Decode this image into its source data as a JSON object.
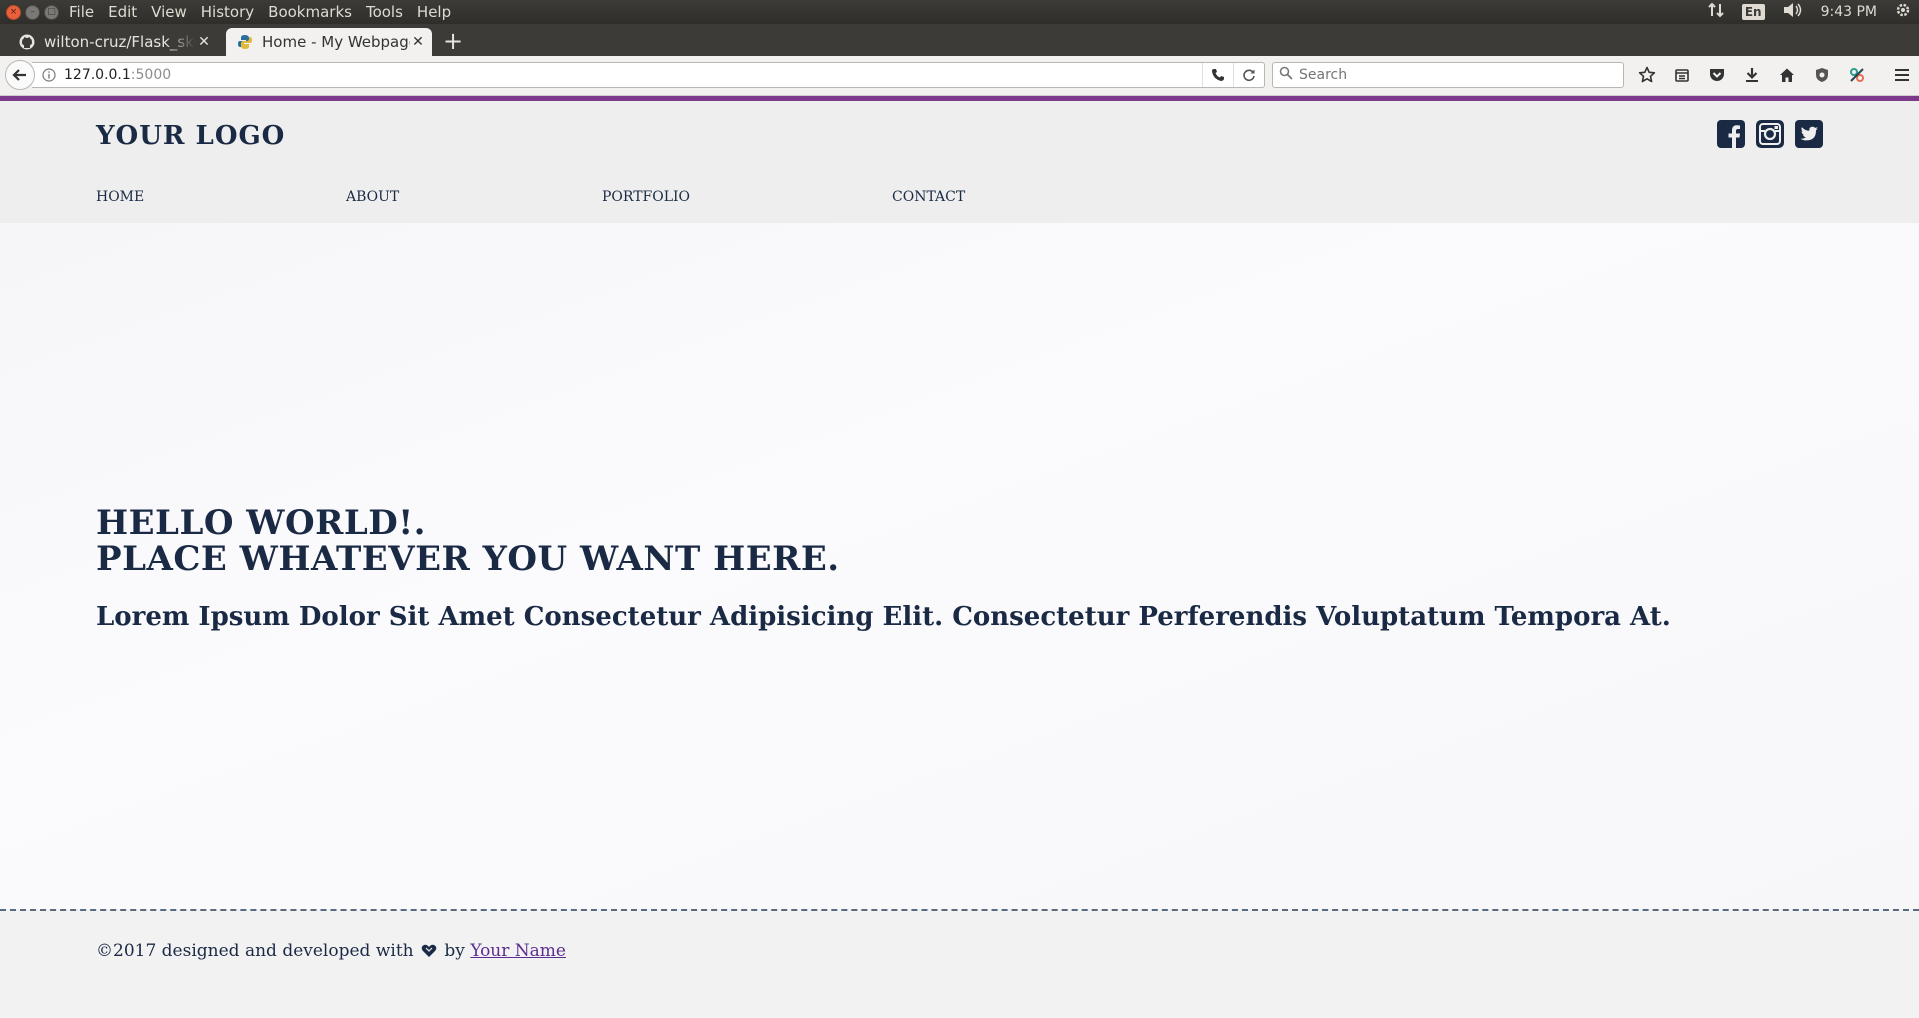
{
  "os": {
    "menu": [
      "File",
      "Edit",
      "View",
      "History",
      "Bookmarks",
      "Tools",
      "Help"
    ],
    "keyboard_layout": "En",
    "clock": "9:43 PM"
  },
  "browser": {
    "tabs": [
      {
        "label": "wilton-cruz/Flask_skeleton",
        "active": false,
        "icon": "github-icon"
      },
      {
        "label": "Home - My Webpage",
        "active": true,
        "icon": "python-icon"
      }
    ],
    "url_host": "127.0.0.1",
    "url_port": ":5000",
    "search_placeholder": "Search"
  },
  "site": {
    "logo": "YOUR LOGO",
    "nav": [
      "HOME",
      "ABOUT",
      "PORTFOLIO",
      "CONTACT"
    ],
    "socials": [
      "facebook-icon",
      "instagram-icon",
      "twitter-icon"
    ],
    "hero": {
      "line1": "HELLO WORLD!.",
      "line2": "PLACE WHATEVER YOU WANT HERE.",
      "subtitle": "Lorem Ipsum Dolor Sit Amet Consectetur Adipisicing Elit. Consectetur Perferendis Voluptatum Tempora At."
    },
    "footer": {
      "prefix": "©2017 designed and developed with",
      "by": "by",
      "author": "Your Name"
    }
  },
  "colors": {
    "accent": "#7d3a8c",
    "text": "#1a2a45",
    "link": "#5c2d91"
  }
}
